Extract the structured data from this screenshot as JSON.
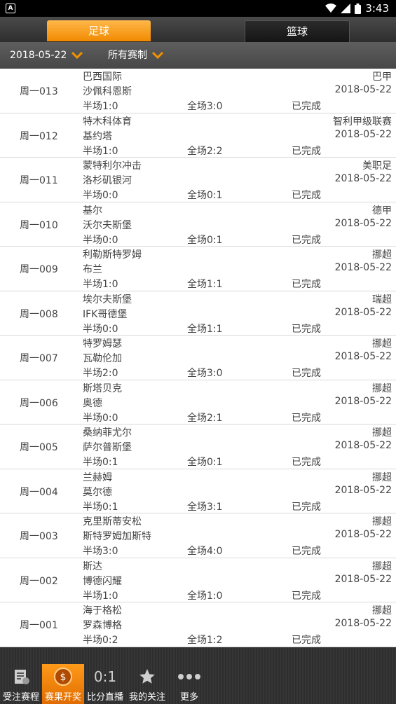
{
  "status_bar": {
    "time": "3:43"
  },
  "tabs": [
    {
      "label": "足球"
    },
    {
      "label": "篮球"
    }
  ],
  "filters": {
    "date": "2018-05-22",
    "league": "所有赛制"
  },
  "matches": [
    {
      "code": "周一013",
      "home": "巴西国际",
      "away": "沙佩科恩斯",
      "half": "半场1:0",
      "full": "全场3:0",
      "status": "已完成",
      "league": "巴甲",
      "date": "2018-05-22"
    },
    {
      "code": "周一012",
      "home": "特木科体育",
      "away": "基约塔",
      "half": "半场1:0",
      "full": "全场2:2",
      "status": "已完成",
      "league": "智利甲级联赛",
      "date": "2018-05-22"
    },
    {
      "code": "周一011",
      "home": "蒙特利尔冲击",
      "away": "洛杉矶银河",
      "half": "半场0:0",
      "full": "全场0:1",
      "status": "已完成",
      "league": "美职足",
      "date": "2018-05-22"
    },
    {
      "code": "周一010",
      "home": "基尔",
      "away": "沃尔夫斯堡",
      "half": "半场0:0",
      "full": "全场0:1",
      "status": "已完成",
      "league": "德甲",
      "date": "2018-05-22"
    },
    {
      "code": "周一009",
      "home": "利勒斯特罗姆",
      "away": "布兰",
      "half": "半场1:0",
      "full": "全场1:1",
      "status": "已完成",
      "league": "挪超",
      "date": "2018-05-22"
    },
    {
      "code": "周一008",
      "home": "埃尔夫斯堡",
      "away": "IFK哥德堡",
      "half": "半场0:0",
      "full": "全场1:1",
      "status": "已完成",
      "league": "瑞超",
      "date": "2018-05-22"
    },
    {
      "code": "周一007",
      "home": "特罗姆瑟",
      "away": "瓦勒伦加",
      "half": "半场2:0",
      "full": "全场3:0",
      "status": "已完成",
      "league": "挪超",
      "date": "2018-05-22"
    },
    {
      "code": "周一006",
      "home": "斯塔贝克",
      "away": "奥德",
      "half": "半场0:0",
      "full": "全场2:1",
      "status": "已完成",
      "league": "挪超",
      "date": "2018-05-22"
    },
    {
      "code": "周一005",
      "home": "桑纳菲尤尔",
      "away": "萨尔普斯堡",
      "half": "半场0:1",
      "full": "全场0:1",
      "status": "已完成",
      "league": "挪超",
      "date": "2018-05-22"
    },
    {
      "code": "周一004",
      "home": "兰赫姆",
      "away": "莫尔德",
      "half": "半场0:1",
      "full": "全场3:1",
      "status": "已完成",
      "league": "挪超",
      "date": "2018-05-22"
    },
    {
      "code": "周一003",
      "home": "克里斯蒂安松",
      "away": "斯特罗姆加斯特",
      "half": "半场3:0",
      "full": "全场4:0",
      "status": "已完成",
      "league": "挪超",
      "date": "2018-05-22"
    },
    {
      "code": "周一002",
      "home": "斯达",
      "away": "博德闪耀",
      "half": "半场1:0",
      "full": "全场1:0",
      "status": "已完成",
      "league": "挪超",
      "date": "2018-05-22"
    },
    {
      "code": "周一001",
      "home": "海于格松",
      "away": "罗森博格",
      "half": "半场0:2",
      "full": "全场1:2",
      "status": "已完成",
      "league": "挪超",
      "date": "2018-05-22"
    }
  ],
  "bottom_nav": [
    {
      "label": "受注赛程",
      "icon": "schedule-icon",
      "active": false
    },
    {
      "label": "赛果开奖",
      "icon": "coin-icon",
      "active": true
    },
    {
      "label": "比分直播",
      "icon": "score-icon",
      "icon_text": "0:1",
      "active": false
    },
    {
      "label": "我的关注",
      "icon": "star-icon",
      "active": false
    },
    {
      "label": "更多",
      "icon": "more-icon",
      "active": false
    }
  ],
  "colors": {
    "accent": "#f39200",
    "header": "#3a3a3a",
    "divider": "#d9d9d9"
  }
}
